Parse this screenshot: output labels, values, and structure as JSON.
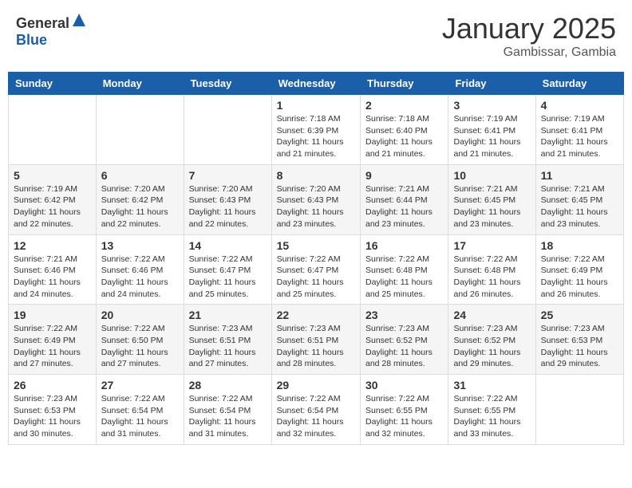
{
  "header": {
    "logo_general": "General",
    "logo_blue": "Blue",
    "month_year": "January 2025",
    "location": "Gambissar, Gambia"
  },
  "days_of_week": [
    "Sunday",
    "Monday",
    "Tuesday",
    "Wednesday",
    "Thursday",
    "Friday",
    "Saturday"
  ],
  "weeks": [
    [
      {
        "day": "",
        "info": ""
      },
      {
        "day": "",
        "info": ""
      },
      {
        "day": "",
        "info": ""
      },
      {
        "day": "1",
        "info": "Sunrise: 7:18 AM\nSunset: 6:39 PM\nDaylight: 11 hours and 21 minutes."
      },
      {
        "day": "2",
        "info": "Sunrise: 7:18 AM\nSunset: 6:40 PM\nDaylight: 11 hours and 21 minutes."
      },
      {
        "day": "3",
        "info": "Sunrise: 7:19 AM\nSunset: 6:41 PM\nDaylight: 11 hours and 21 minutes."
      },
      {
        "day": "4",
        "info": "Sunrise: 7:19 AM\nSunset: 6:41 PM\nDaylight: 11 hours and 21 minutes."
      }
    ],
    [
      {
        "day": "5",
        "info": "Sunrise: 7:19 AM\nSunset: 6:42 PM\nDaylight: 11 hours and 22 minutes."
      },
      {
        "day": "6",
        "info": "Sunrise: 7:20 AM\nSunset: 6:42 PM\nDaylight: 11 hours and 22 minutes."
      },
      {
        "day": "7",
        "info": "Sunrise: 7:20 AM\nSunset: 6:43 PM\nDaylight: 11 hours and 22 minutes."
      },
      {
        "day": "8",
        "info": "Sunrise: 7:20 AM\nSunset: 6:43 PM\nDaylight: 11 hours and 23 minutes."
      },
      {
        "day": "9",
        "info": "Sunrise: 7:21 AM\nSunset: 6:44 PM\nDaylight: 11 hours and 23 minutes."
      },
      {
        "day": "10",
        "info": "Sunrise: 7:21 AM\nSunset: 6:45 PM\nDaylight: 11 hours and 23 minutes."
      },
      {
        "day": "11",
        "info": "Sunrise: 7:21 AM\nSunset: 6:45 PM\nDaylight: 11 hours and 23 minutes."
      }
    ],
    [
      {
        "day": "12",
        "info": "Sunrise: 7:21 AM\nSunset: 6:46 PM\nDaylight: 11 hours and 24 minutes."
      },
      {
        "day": "13",
        "info": "Sunrise: 7:22 AM\nSunset: 6:46 PM\nDaylight: 11 hours and 24 minutes."
      },
      {
        "day": "14",
        "info": "Sunrise: 7:22 AM\nSunset: 6:47 PM\nDaylight: 11 hours and 25 minutes."
      },
      {
        "day": "15",
        "info": "Sunrise: 7:22 AM\nSunset: 6:47 PM\nDaylight: 11 hours and 25 minutes."
      },
      {
        "day": "16",
        "info": "Sunrise: 7:22 AM\nSunset: 6:48 PM\nDaylight: 11 hours and 25 minutes."
      },
      {
        "day": "17",
        "info": "Sunrise: 7:22 AM\nSunset: 6:48 PM\nDaylight: 11 hours and 26 minutes."
      },
      {
        "day": "18",
        "info": "Sunrise: 7:22 AM\nSunset: 6:49 PM\nDaylight: 11 hours and 26 minutes."
      }
    ],
    [
      {
        "day": "19",
        "info": "Sunrise: 7:22 AM\nSunset: 6:49 PM\nDaylight: 11 hours and 27 minutes."
      },
      {
        "day": "20",
        "info": "Sunrise: 7:22 AM\nSunset: 6:50 PM\nDaylight: 11 hours and 27 minutes."
      },
      {
        "day": "21",
        "info": "Sunrise: 7:23 AM\nSunset: 6:51 PM\nDaylight: 11 hours and 27 minutes."
      },
      {
        "day": "22",
        "info": "Sunrise: 7:23 AM\nSunset: 6:51 PM\nDaylight: 11 hours and 28 minutes."
      },
      {
        "day": "23",
        "info": "Sunrise: 7:23 AM\nSunset: 6:52 PM\nDaylight: 11 hours and 28 minutes."
      },
      {
        "day": "24",
        "info": "Sunrise: 7:23 AM\nSunset: 6:52 PM\nDaylight: 11 hours and 29 minutes."
      },
      {
        "day": "25",
        "info": "Sunrise: 7:23 AM\nSunset: 6:53 PM\nDaylight: 11 hours and 29 minutes."
      }
    ],
    [
      {
        "day": "26",
        "info": "Sunrise: 7:23 AM\nSunset: 6:53 PM\nDaylight: 11 hours and 30 minutes."
      },
      {
        "day": "27",
        "info": "Sunrise: 7:22 AM\nSunset: 6:54 PM\nDaylight: 11 hours and 31 minutes."
      },
      {
        "day": "28",
        "info": "Sunrise: 7:22 AM\nSunset: 6:54 PM\nDaylight: 11 hours and 31 minutes."
      },
      {
        "day": "29",
        "info": "Sunrise: 7:22 AM\nSunset: 6:54 PM\nDaylight: 11 hours and 32 minutes."
      },
      {
        "day": "30",
        "info": "Sunrise: 7:22 AM\nSunset: 6:55 PM\nDaylight: 11 hours and 32 minutes."
      },
      {
        "day": "31",
        "info": "Sunrise: 7:22 AM\nSunset: 6:55 PM\nDaylight: 11 hours and 33 minutes."
      },
      {
        "day": "",
        "info": ""
      }
    ]
  ]
}
